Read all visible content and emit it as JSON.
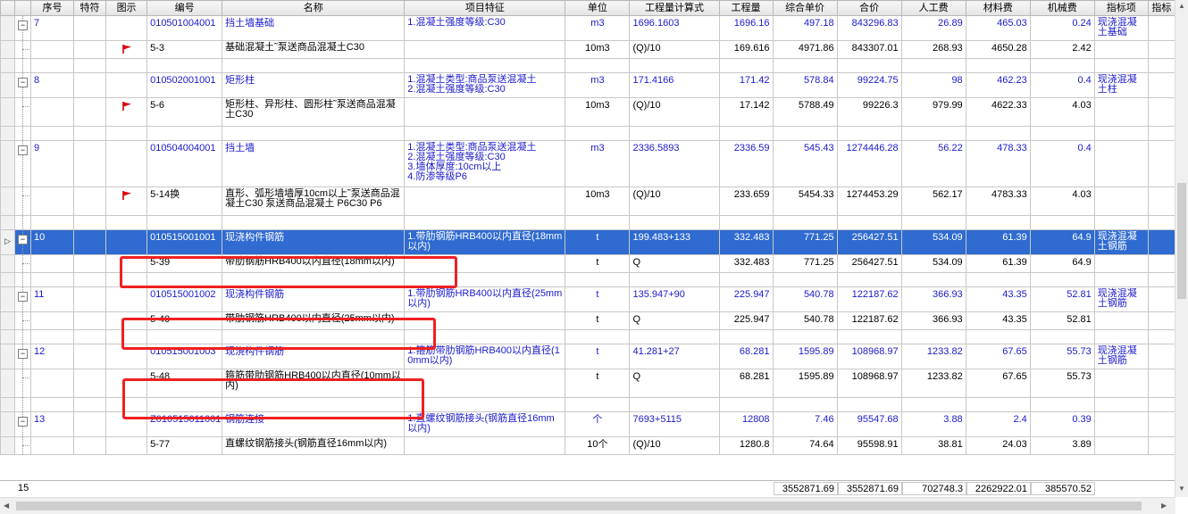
{
  "headers": [
    "",
    "",
    "序号",
    "特符",
    "图示",
    "编号",
    "名称",
    "项目特征",
    "单位",
    "工程量计算式",
    "工程量",
    "综合单价",
    "合价",
    "人工费",
    "材料费",
    "机械费",
    "指标项",
    "指标"
  ],
  "rows": [
    {
      "kind": "item",
      "seq": "7",
      "code": "010501004001",
      "name": "挡土墙基础",
      "feature": "1.混凝土强度等级:C30",
      "unit": "m3",
      "formula": "1696.1603",
      "qty": "1696.16",
      "price": "497.18",
      "total": "843296.83",
      "labor": "26.89",
      "material": "465.03",
      "machine": "0.24",
      "index": "现浇混凝土基础"
    },
    {
      "kind": "sub",
      "flag": true,
      "code": "5-3",
      "name": "基础混凝土˜泵送商品混凝土C30",
      "feature": "",
      "unit": "10m3",
      "formula": "(Q)/10",
      "qty": "169.616",
      "price": "4971.86",
      "total": "843307.01",
      "labor": "268.93",
      "material": "4650.28",
      "machine": "2.42",
      "index": ""
    },
    {
      "kind": "blank"
    },
    {
      "kind": "item",
      "seq": "8",
      "code": "010502001001",
      "name": "矩形柱",
      "feature": "1.混凝土类型:商品泵送混凝土\n2.混凝土强度等级:C30",
      "unit": "m3",
      "formula": "171.4166",
      "qty": "171.42",
      "price": "578.84",
      "total": "99224.75",
      "labor": "98",
      "material": "462.23",
      "machine": "0.4",
      "index": "现浇混凝土柱"
    },
    {
      "kind": "sub",
      "flag": true,
      "code": "5-6",
      "name": "矩形柱、异形柱、圆形柱˜泵送商品混凝土C30",
      "feature": "",
      "unit": "10m3",
      "formula": "(Q)/10",
      "qty": "17.142",
      "price": "5788.49",
      "total": "99226.3",
      "labor": "979.99",
      "material": "4622.33",
      "machine": "4.03",
      "index": ""
    },
    {
      "kind": "blank"
    },
    {
      "kind": "item",
      "seq": "9",
      "code": "010504004001",
      "name": "挡土墙",
      "feature": "1.混凝土类型:商品泵送混凝土\n2.混凝土强度等级:C30\n3.墙体厚度:10cm以上\n4.防渗等级P6",
      "unit": "m3",
      "formula": "2336.5893",
      "qty": "2336.59",
      "price": "545.43",
      "total": "1274446.28",
      "labor": "56.22",
      "material": "478.33",
      "machine": "0.4",
      "index": ""
    },
    {
      "kind": "sub",
      "flag": true,
      "code": "5-14换",
      "name": "直形、弧形墙墙厚10cm以上˜泵送商品混凝土C30 泵送商品混凝土 P6C30 P6",
      "feature": "",
      "unit": "10m3",
      "formula": "(Q)/10",
      "qty": "233.659",
      "price": "5454.33",
      "total": "1274453.29",
      "labor": "562.17",
      "material": "4783.33",
      "machine": "4.03",
      "index": ""
    },
    {
      "kind": "blank"
    },
    {
      "kind": "item",
      "sel": true,
      "seq": "10",
      "code": "010515001001",
      "name": "现浇构件钢筋",
      "feature": "1.带肋钢筋HRB400以内直径(18mm以内)",
      "unit": "t",
      "formula": "199.483+133",
      "qty": "332.483",
      "price": "771.25",
      "total": "256427.51",
      "labor": "534.09",
      "material": "61.39",
      "machine": "64.9",
      "index": "现浇混凝土钢筋"
    },
    {
      "kind": "sub",
      "code": "5-39",
      "name": "带肋钢筋HRB400以内直径(18mm以内)",
      "feature": "",
      "unit": "t",
      "formula": "Q",
      "qty": "332.483",
      "price": "771.25",
      "total": "256427.51",
      "labor": "534.09",
      "material": "61.39",
      "machine": "64.9",
      "index": ""
    },
    {
      "kind": "blank"
    },
    {
      "kind": "item",
      "seq": "11",
      "code": "010515001002",
      "name": "现浇构件钢筋",
      "feature": "1.带肋钢筋HRB400以内直径(25mm以内)",
      "unit": "t",
      "formula": "135.947+90",
      "qty": "225.947",
      "price": "540.78",
      "total": "122187.62",
      "labor": "366.93",
      "material": "43.35",
      "machine": "52.81",
      "index": "现浇混凝土钢筋"
    },
    {
      "kind": "sub",
      "code": "5-40",
      "name": "带肋钢筋HRB400以内直径(25mm以内)",
      "feature": "",
      "unit": "t",
      "formula": "Q",
      "qty": "225.947",
      "price": "540.78",
      "total": "122187.62",
      "labor": "366.93",
      "material": "43.35",
      "machine": "52.81",
      "index": ""
    },
    {
      "kind": "blank"
    },
    {
      "kind": "item",
      "seq": "12",
      "code": "010515001003",
      "name": "现浇构件钢筋",
      "feature": "1.箍筋带肋钢筋HRB400以内直径(10mm以内)",
      "unit": "t",
      "formula": "41.281+27",
      "qty": "68.281",
      "price": "1595.89",
      "total": "108968.97",
      "labor": "1233.82",
      "material": "67.65",
      "machine": "55.73",
      "index": "现浇混凝土钢筋"
    },
    {
      "kind": "sub",
      "code": "5-48",
      "name": "箍筋带肋钢筋HRB400以内直径(10mm以内)",
      "feature": "",
      "unit": "t",
      "formula": "Q",
      "qty": "68.281",
      "price": "1595.89",
      "total": "108968.97",
      "labor": "1233.82",
      "material": "67.65",
      "machine": "55.73",
      "index": ""
    },
    {
      "kind": "blank"
    },
    {
      "kind": "item",
      "seq": "13",
      "code": "Z010515011001",
      "name": "钢筋连接",
      "feature": "1.直螺纹钢筋接头(钢筋直径16mm以内)",
      "unit": "个",
      "formula": "7693+5115",
      "qty": "12808",
      "price": "7.46",
      "total": "95547.68",
      "labor": "3.88",
      "material": "2.4",
      "machine": "0.39",
      "index": ""
    },
    {
      "kind": "sub",
      "code": "5-77",
      "name": "直螺纹钢筋接头(钢筋直径16mm以内)",
      "feature": "",
      "unit": "10个",
      "formula": "(Q)/10",
      "qty": "1280.8",
      "price": "74.64",
      "total": "95598.91",
      "labor": "38.81",
      "material": "24.03",
      "machine": "3.89",
      "index": ""
    }
  ],
  "summary": {
    "count": "15",
    "qty_sum": "3552871.69",
    "total_sum": "3552871.69",
    "labor_sum": "702748.3",
    "material_sum": "2262922.01",
    "machine_sum": "385570.52"
  },
  "colors": {
    "selected_row": "#2f6bd0",
    "highlight_box": "#f02020",
    "link_text": "#1a1acc"
  }
}
